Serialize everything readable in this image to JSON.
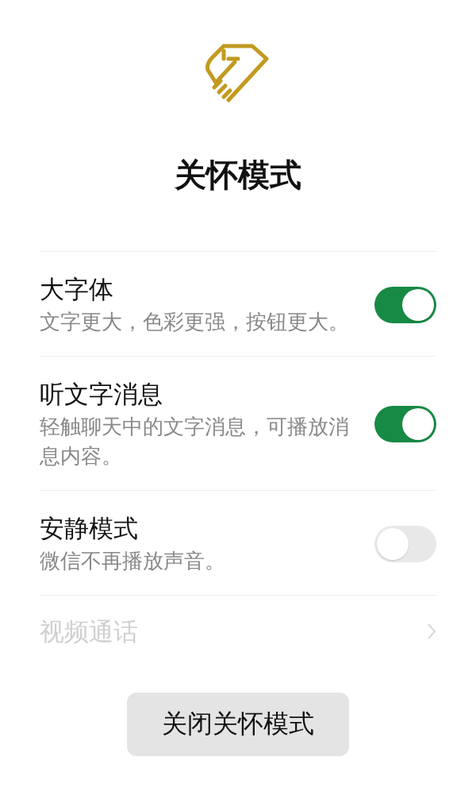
{
  "title": "关怀模式",
  "settings": [
    {
      "kind": "toggle",
      "label": "大字体",
      "description": "文字更大，色彩更强，按钮更大。",
      "on": true
    },
    {
      "kind": "toggle",
      "label": "听文字消息",
      "description": "轻触聊天中的文字消息，可播放消息内容。",
      "on": true
    },
    {
      "kind": "toggle",
      "label": "安静模式",
      "description": "微信不再播放声音。",
      "on": false
    },
    {
      "kind": "link",
      "label": "视频通话"
    }
  ],
  "button": "关闭关怀模式"
}
